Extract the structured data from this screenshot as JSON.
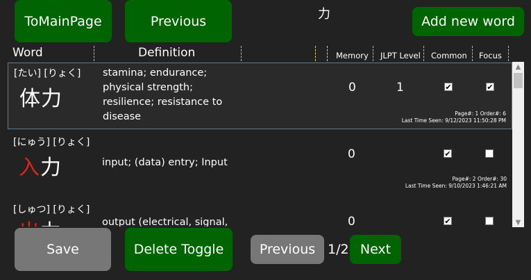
{
  "top": {
    "to_main_label": "ToMainPage",
    "previous_label": "Previous",
    "title_kanji": "力",
    "add_word_label": "Add new word"
  },
  "columns": {
    "word": "Word",
    "definition": "Definition",
    "memory": "Memory",
    "jlpt": "JLPT Level",
    "common": "Common",
    "focus": "Focus"
  },
  "rows": [
    {
      "reading": "[たい] [りょく]",
      "kanji_pre": "体",
      "kanji_red": "",
      "kanji_post": "力",
      "definition": "stamina; endurance; physical strength; resilience; resistance to disease",
      "memory": "0",
      "jlpt": "1",
      "common": true,
      "focus": true,
      "meta_line1": "Page#:  1    Order#:  6",
      "meta_line2": "Last Time Seen:  9/12/2023 11:50:28 PM"
    },
    {
      "reading": "[にゅう] [りょく]",
      "kanji_pre": "",
      "kanji_red": "入",
      "kanji_post": "力",
      "definition": "input; (data) entry; Input",
      "memory": "0",
      "jlpt": "",
      "common": true,
      "focus": false,
      "meta_line1": "Page#:  2    Order#:  30",
      "meta_line2": "Last Time Seen:  9/10/2023 1:46:21 AM"
    },
    {
      "reading": "[しゅつ] [りょく]",
      "kanji_pre": "",
      "kanji_red": "出",
      "kanji_post": "力",
      "definition": "output (electrical, signal,",
      "memory": "0",
      "jlpt": "",
      "common": true,
      "focus": false
    }
  ],
  "bottom": {
    "save_label": "Save",
    "delete_toggle_label": "Delete Toggle",
    "page_prev_label": "Previous",
    "page_indicator": "1/2",
    "next_label": "Next"
  },
  "colors": {
    "background": "#222222",
    "green_button": "#006400",
    "gray_button": "#777777",
    "highlight_kanji": "#e0231b"
  }
}
